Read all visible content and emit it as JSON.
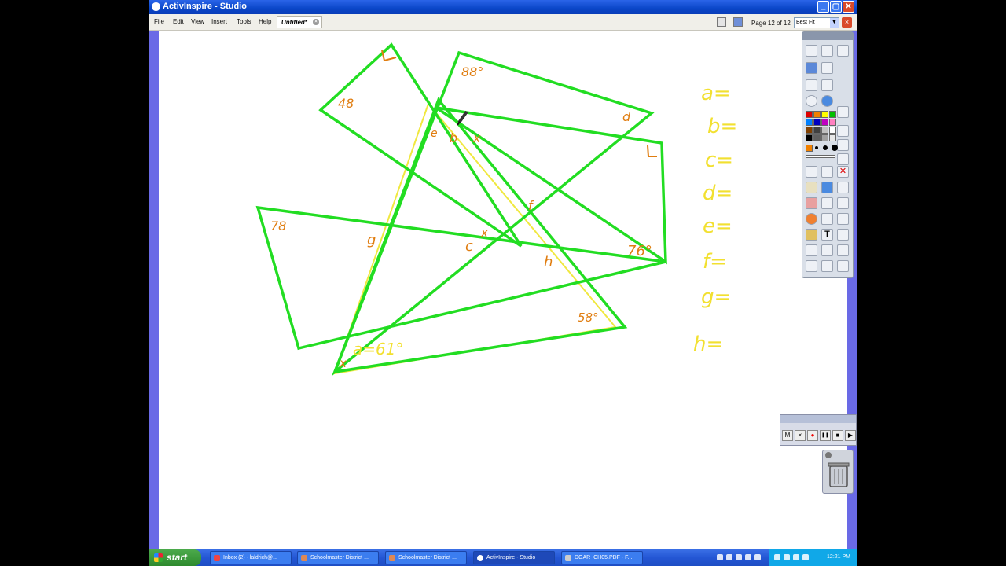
{
  "window": {
    "title": "ActivInspire - Studio"
  },
  "menu": {
    "items": [
      "File",
      "Edit",
      "View",
      "Insert",
      "Tools",
      "Help"
    ]
  },
  "document_tab": {
    "label": "Untitled*"
  },
  "page_indicator": "Page 12 of 12",
  "zoom": {
    "selected": "Best Fit"
  },
  "worksheet": {
    "angle_labels": [
      "48",
      "88°",
      "d",
      "e",
      "b",
      "x",
      "f",
      "78",
      "g",
      "c",
      "x",
      "h",
      "76°",
      "58°",
      "x",
      "a=61°"
    ],
    "answer_labels": [
      "a=",
      "b=",
      "c=",
      "d=",
      "e=",
      "f=",
      "g=",
      "h="
    ],
    "colors": {
      "triangle": "#22dd22",
      "annotation": "#e07d10",
      "answers": "#f2e030",
      "highlight": "#f0e840"
    }
  },
  "recorder": {
    "buttons": [
      "M",
      "×",
      "●",
      "❚❚",
      "■",
      "▶"
    ]
  },
  "taskbar": {
    "start_label": "start",
    "tasks": [
      "Inbox (2) - laldrich@...",
      "Schoolmaster District ...",
      "Schoolmaster District ...",
      "ActivInspire - Studio",
      "DGAR_CH05.PDF - F..."
    ],
    "clock": "12:21 PM"
  }
}
